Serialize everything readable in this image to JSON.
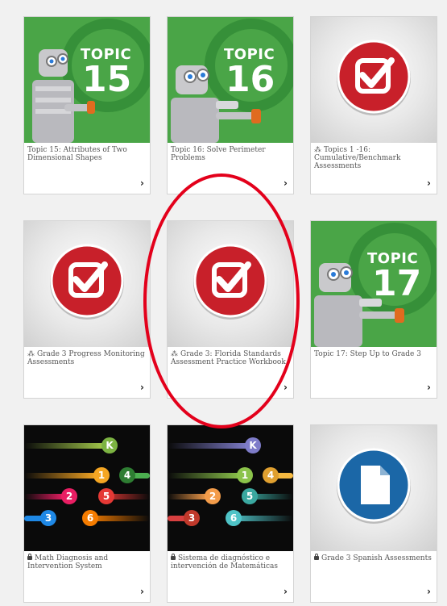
{
  "cards": [
    {
      "label": "Topic 15: Attributes of Two Dimensional Shapes",
      "topic_word": "TOPIC",
      "topic_number": "15",
      "icon": "robot-topic-banner"
    },
    {
      "label": "Topic 16: Solve Perimeter Problems",
      "topic_word": "TOPIC",
      "topic_number": "16",
      "icon": "robot-topic-banner"
    },
    {
      "label": "Topics 1 -16: Cumulative/Benchmark Assessments",
      "icon": "assessment-check-icon",
      "prefix_icon": "network-icon"
    },
    {
      "label": "Grade 3 Progress Monitoring Assessments",
      "icon": "assessment-check-icon",
      "prefix_icon": "network-icon"
    },
    {
      "label": "Grade 3: Florida Standards Assessment Practice Workbook",
      "icon": "assessment-check-icon",
      "prefix_icon": "network-icon"
    },
    {
      "label": "Topic 17: Step Up to Grade 3",
      "topic_word": "TOPIC",
      "topic_number": "17",
      "icon": "robot-topic-banner"
    },
    {
      "label": "Math Diagnosis and Intervention System",
      "icon": "level-bars-graphic",
      "prefix_icon": "lock-icon"
    },
    {
      "label": "Sistema de diagnóstico e intervención de Matemáticas",
      "icon": "level-bars-graphic",
      "prefix_icon": "lock-icon"
    },
    {
      "label": "Grade 3 Spanish Assessments",
      "icon": "document-icon",
      "prefix_icon": "lock-icon"
    }
  ],
  "level_letters": [
    "K",
    "1",
    "4",
    "2",
    "5",
    "3",
    "6"
  ],
  "chevron": "›",
  "colors": {
    "topic_green": "#4aa547",
    "check_red": "#c8202a",
    "doc_blue": "#1b67a7",
    "highlight_ring": "#e3001b"
  }
}
